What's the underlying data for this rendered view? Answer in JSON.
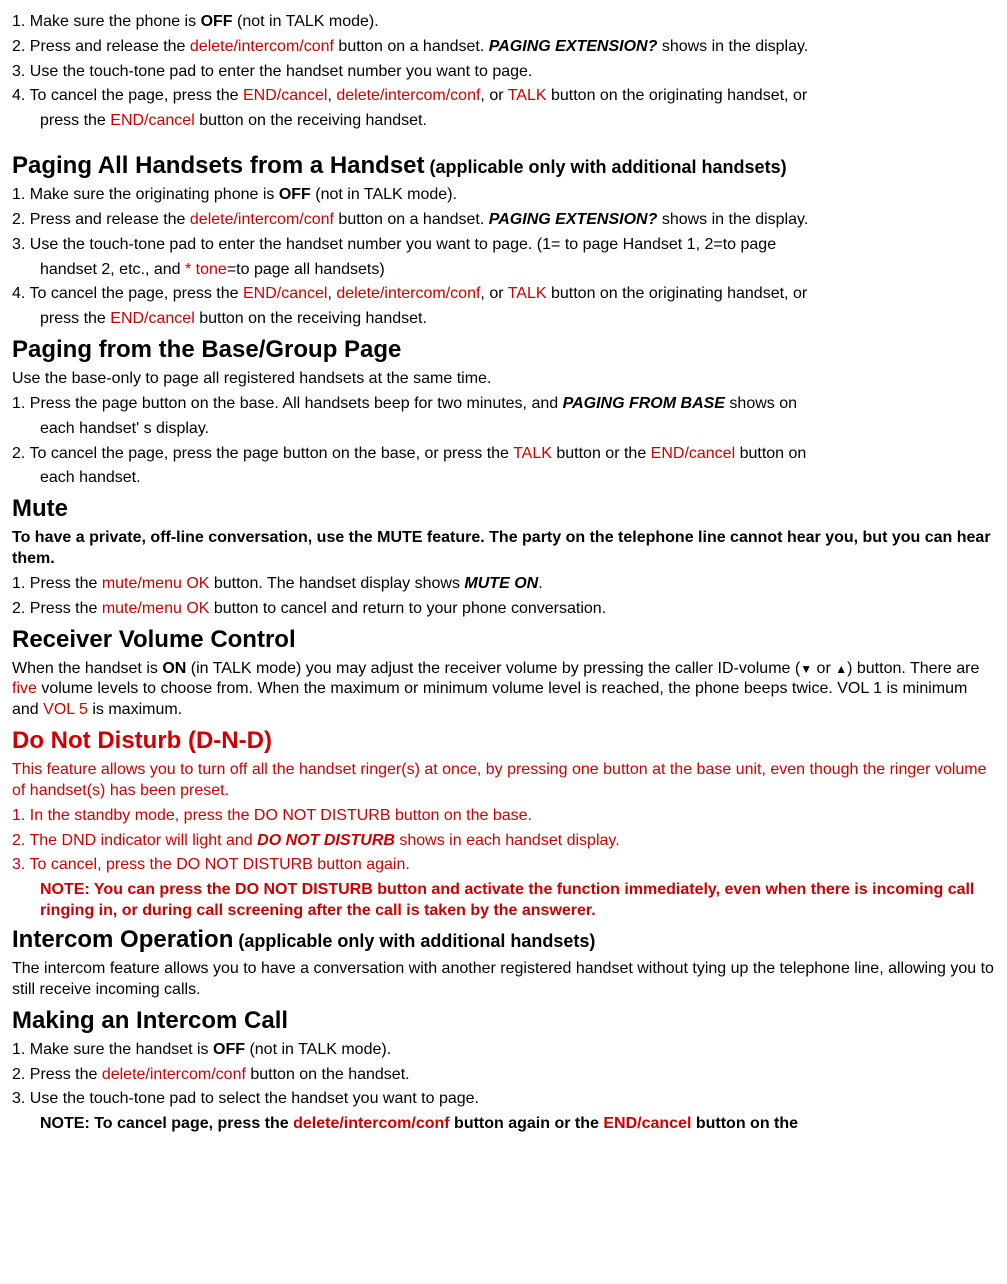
{
  "s1": {
    "p1a": "1. Make sure the phone is ",
    "p1b": "OFF",
    "p1c": " (not in TALK mode).",
    "p2a": "2. Press and release the ",
    "p2b": "delete/intercom/conf",
    "p2c": " button on a handset. ",
    "p2d": "PAGING EXTENSION?",
    "p2e": " shows in the display.",
    "p3": "3. Use the touch-tone pad to enter the handset number you want to page.",
    "p4a": "4. To cancel the page, press the ",
    "p4b": "END/cancel",
    "p4c": ", ",
    "p4d": "delete/intercom/conf",
    "p4e": ", or ",
    "p4f": "TALK",
    "p4g": " button on the originating handset, or ",
    "p4h": "press the ",
    "p4i": "END/cancel",
    "p4j": " button on the receiving handset."
  },
  "h2a": "Paging All Handsets from a Handset",
  "h2a_paren": " (applicable only with additional handsets)",
  "s2": {
    "p1a": "1. Make sure the originating phone is ",
    "p1b": "OFF",
    "p1c": " (not in TALK mode).",
    "p2a": "2. Press and release the ",
    "p2b": "delete/intercom/conf",
    "p2c": " button on a handset. ",
    "p2d": "PAGING EXTENSION?",
    "p2e": " shows in the display.",
    "p3a": "3. Use the touch-tone pad to enter the handset number you want to page. (1= to page Handset 1, 2=to page ",
    "p3b": "handset 2, etc., and ",
    "p3c": "* tone",
    "p3d": "=to page all handsets)",
    "p4a": "4. To cancel the page, press the ",
    "p4b": "END/cancel",
    "p4c": ", ",
    "p4d": "delete/intercom/conf",
    "p4e": ", or ",
    "p4f": "TALK",
    "p4g": " button on the originating handset, or ",
    "p4h": "press the ",
    "p4i": "END/cancel",
    "p4j": " button on the receiving handset."
  },
  "h3": "Paging from the Base/Group Page",
  "s3": {
    "intro": "Use the base-only to page all registered handsets at the same time.",
    "p1a": "1. Press the page button on the base. All handsets beep for two minutes, and ",
    "p1b": "PAGING FROM BASE",
    "p1c": " shows on ",
    "p1d": "each handset' s display.",
    "p2a": "2. To cancel the page, press the page button on the base, or press the ",
    "p2b": "TALK",
    "p2c": " button or the ",
    "p2d": "END/cancel",
    "p2e": " button on ",
    "p2f": "each handset."
  },
  "h4": "Mute",
  "s4": {
    "intro": "To have a private, off-line conversation, use the MUTE feature. The party on the telephone line cannot hear you, but you can hear them.",
    "p1a": "1. Press the ",
    "p1b": "mute/menu OK",
    "p1c": " button. The handset display shows ",
    "p1d": "MUTE ON",
    "p1e": ".",
    "p2a": "2. Press the ",
    "p2b": "mute/menu OK",
    "p2c": " button to cancel and return to your phone conversation."
  },
  "h5": "Receiver Volume Control",
  "s5": {
    "p1a": "When the handset is ",
    "p1b": "ON",
    "p1c": " (in TALK mode) you may adjust the receiver volume by pressing the caller ID-volume (",
    "p1d": "▼",
    "p1e": "  or ",
    "p1f": "▲",
    "p1g": ") button. There are ",
    "p1h": "five",
    "p1i": " volume levels to choose from. When the maximum or minimum volume level is reached, the phone beeps twice. VOL 1 is minimum and ",
    "p1j": "VOL 5",
    "p1k": " is maximum."
  },
  "h6": "Do Not Disturb (D-N-D)",
  "s6": {
    "intro": "This feature allows you to turn off all the handset ringer(s) at once, by pressing one button at the base unit, even though the ringer volume of handset(s) has been preset.",
    "p1": "1. In the standby mode, press the DO NOT DISTURB button on the base.",
    "p2a": "2. The DND indicator will light and ",
    "p2b": "DO NOT DISTURB",
    "p2c": " shows in each handset display.",
    "p3": "3. To cancel, press the DO NOT DISTURB button again.",
    "note": "NOTE: You can press the DO NOT DISTURB button and activate the function immediately, even when there is incoming call ringing in, or during call screening after the call is taken by the answerer."
  },
  "h7a": "Intercom Operation",
  "h7b": " (applicable only with additional handsets)",
  "s7": {
    "intro": "The intercom feature allows you to have a conversation with another registered handset without tying up the telephone line, allowing you to still receive incoming calls."
  },
  "h8": "Making an Intercom Call",
  "s8": {
    "p1a": "1. Make sure the handset is ",
    "p1b": "OFF",
    "p1c": " (not in TALK mode).",
    "p2a": "2. Press the ",
    "p2b": "delete/intercom/conf",
    "p2c": " button on the handset.",
    "p3": "3. Use the touch-tone pad to select the handset you want to page.",
    "note_a": "NOTE: To cancel page, press the ",
    "note_b": "delete/intercom/conf",
    "note_c": " button again or the ",
    "note_d": "END/cancel",
    "note_e": " button on the"
  }
}
